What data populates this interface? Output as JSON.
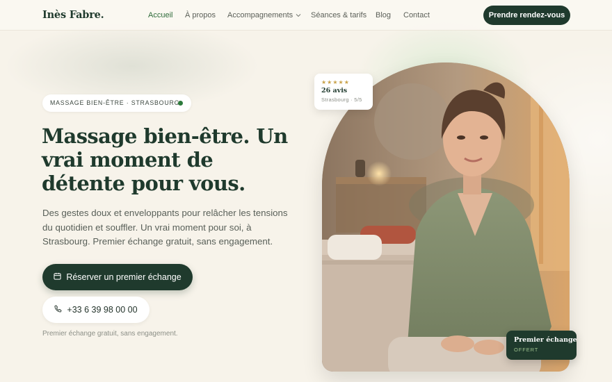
{
  "brand": "Inès Fabre.",
  "nav": {
    "links": [
      {
        "label": "Accueil",
        "active": true
      },
      {
        "label": "À propos"
      },
      {
        "label": "Accompagnements",
        "dropdown": true
      },
      {
        "label": "Séances & tarifs"
      },
      {
        "label": "Blog"
      },
      {
        "label": "Contact"
      }
    ],
    "cta": "Prendre rendez-vous"
  },
  "hero": {
    "badge": "MASSAGE BIEN-ÊTRE · STRASBOURG",
    "title": "Massage bien-être. Un vrai moment de détente pour vous.",
    "subtitle": "Des gestes doux et enveloppants pour relâcher les tensions du quotidien et souffler. Un vrai moment pour soi, à Strasbourg. Premier échange gratuit, sans engagement.",
    "primary_button": "Réserver un premier échange",
    "phone_button": "+33 6 39 98 00 00",
    "note": "Premier échange gratuit, sans engagement."
  },
  "reviews_card": {
    "stars": "★★★★★",
    "count": "26 avis",
    "meta": "Strasbourg · 5/5"
  },
  "offer_card": {
    "title": "Premier échange",
    "subtitle": "OFFERT"
  },
  "colors": {
    "accent": "#1f3a2d",
    "active_link": "#2e6b3a",
    "star": "#c9a24a",
    "offer_sub": "#9fc38f"
  },
  "icons": {
    "primary_button": "calendar-icon",
    "phone_button": "phone-icon",
    "nav_dropdown": "chevron-down-icon"
  }
}
